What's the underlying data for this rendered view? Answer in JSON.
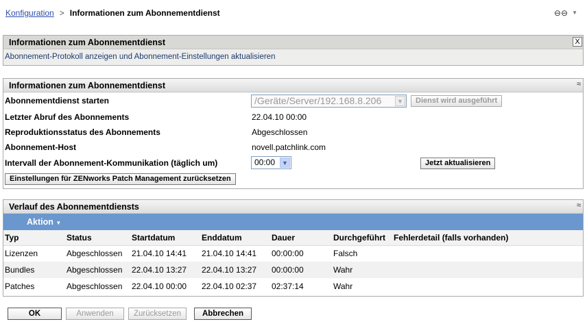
{
  "breadcrumb": {
    "link": "Konfiguration",
    "separator": ">",
    "current": "Informationen zum Abonnementdienst"
  },
  "info_box": {
    "title": "Informationen zum Abonnementdienst",
    "description": "Abonnement-Protokoll anzeigen und Abonnement-Einstellungen aktualisieren",
    "close": "X"
  },
  "section1": {
    "title": "Informationen zum Abonnementdienst",
    "rows": [
      {
        "label": "Abonnementdienst starten",
        "value": "/Geräte/Server/192.168.8.206",
        "button": "Dienst wird ausgeführt"
      },
      {
        "label": "Letzter Abruf des Abonnements",
        "value": "22.04.10 00:00"
      },
      {
        "label": "Reproduktionsstatus des Abonnements",
        "value": "Abgeschlossen"
      },
      {
        "label": "Abonnement-Host",
        "value": "novell.patchlink.com"
      },
      {
        "label": "Intervall der Abonnement-Kommunikation (täglich um)",
        "value": "00:00",
        "button": "Jetzt aktualisieren"
      }
    ],
    "reset_button": "Einstellungen für ZENworks Patch Management zurücksetzen"
  },
  "section2": {
    "title": "Verlauf des Abonnementdiensts",
    "action": "Aktion",
    "columns": [
      "Typ",
      "Status",
      "Startdatum",
      "Enddatum",
      "Dauer",
      "Durchgeführt",
      "Fehlerdetail (falls vorhanden)"
    ],
    "rows": [
      [
        "Lizenzen",
        "Abgeschlossen",
        "21.04.10 14:41",
        "21.04.10 14:41",
        "00:00:00",
        "Falsch",
        ""
      ],
      [
        "Bundles",
        "Abgeschlossen",
        "22.04.10 13:27",
        "22.04.10 13:27",
        "00:00:00",
        "Wahr",
        ""
      ],
      [
        "Patches",
        "Abgeschlossen",
        "22.04.10 00:00",
        "22.04.10 02:37",
        "02:37:14",
        "Wahr",
        ""
      ]
    ]
  },
  "footer": {
    "ok": "OK",
    "apply": "Anwenden",
    "reset": "Zurücksetzen",
    "cancel": "Abbrechen"
  },
  "icons": {
    "link": "link-icon",
    "collapse": "collapse-icon"
  }
}
